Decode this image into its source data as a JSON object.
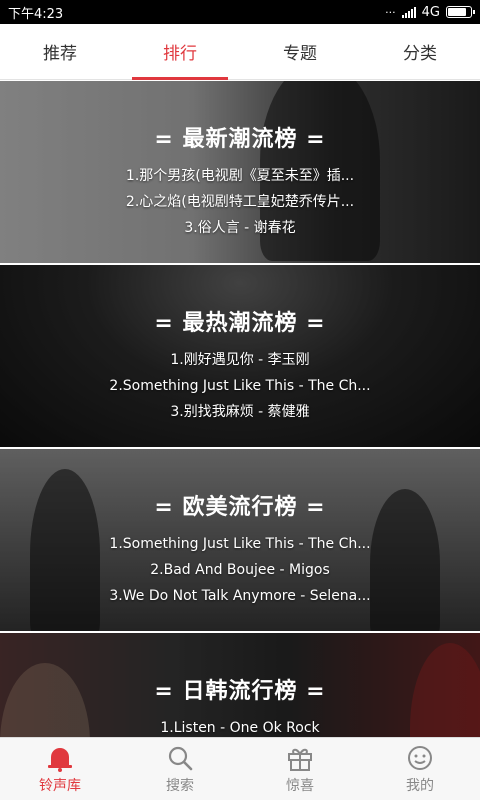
{
  "status": {
    "time": "下午4:23",
    "network": "4G"
  },
  "tabs": [
    {
      "label": "推荐",
      "active": false
    },
    {
      "label": "排行",
      "active": true
    },
    {
      "label": "专题",
      "active": false
    },
    {
      "label": "分类",
      "active": false
    }
  ],
  "charts": [
    {
      "title": "= 最新潮流榜 =",
      "items": [
        "1.那个男孩(电视剧《夏至未至》插...",
        "2.心之焰(电视剧特工皇妃楚乔传片...",
        "3.俗人言 - 谢春花"
      ]
    },
    {
      "title": "= 最热潮流榜 =",
      "items": [
        "1.刚好遇见你 - 李玉刚",
        "2.Something Just Like This - The Ch...",
        "3.别找我麻烦 - 蔡健雅"
      ]
    },
    {
      "title": "= 欧美流行榜 =",
      "items": [
        "1.Something Just Like This - The Ch...",
        "2.Bad And Boujee - Migos",
        "3.We Do Not Talk Anymore - Selena..."
      ]
    },
    {
      "title": "= 日韩流行榜 =",
      "items": [
        "1.Listen - One Ok Rock"
      ]
    }
  ],
  "bottom_nav": [
    {
      "label": "铃声库",
      "icon": "bell-icon",
      "active": true
    },
    {
      "label": "搜索",
      "icon": "search-icon",
      "active": false
    },
    {
      "label": "惊喜",
      "icon": "gift-icon",
      "active": false
    },
    {
      "label": "我的",
      "icon": "face-icon",
      "active": false
    }
  ],
  "colors": {
    "accent": "#e0383e",
    "inactive": "#888888"
  }
}
